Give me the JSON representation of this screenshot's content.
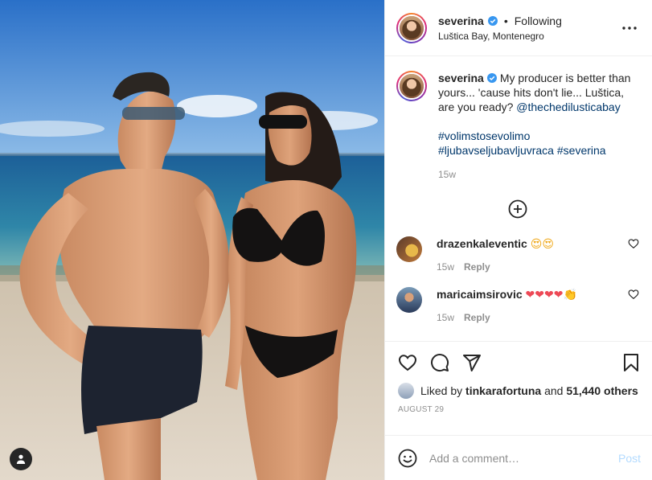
{
  "header": {
    "username": "severina",
    "separator": "•",
    "follow_status": "Following",
    "location": "Luštica Bay, Montenegro"
  },
  "caption": {
    "username": "severina",
    "text": "My producer is better than yours... 'cause hits don't lie... Luštica, are you ready?",
    "mention": "@thechedilusticabay",
    "hashtag_line1": "#volimstosevolimo",
    "hashtag_line2a": "#ljubavseljubavljuvraca",
    "hashtag_line2b": "#severina",
    "time": "15w"
  },
  "comments": [
    {
      "username": "drazenkaleventic",
      "emojis": "😍😍",
      "time": "15w",
      "reply_label": "Reply"
    },
    {
      "username": "maricaimsirovic",
      "emojis": "❤❤❤❤👏",
      "time": "15w",
      "reply_label": "Reply"
    }
  ],
  "likes": {
    "prefix": "Liked by",
    "liker": "tinkarafortuna",
    "and": "and",
    "count": "51,440 others"
  },
  "date": "AUGUST 29",
  "add_comment": {
    "placeholder": "Add a comment…",
    "post_label": "Post"
  },
  "colors": {
    "link": "#00376b",
    "muted": "#8e8e8e",
    "post_disabled": "#b3dbff",
    "verified": "#3897f0"
  },
  "icons": [
    "user-tag-icon",
    "verified-badge-icon",
    "more-options-icon",
    "load-more-icon",
    "heart-icon",
    "comment-icon",
    "share-icon",
    "bookmark-icon",
    "emoji-icon"
  ]
}
